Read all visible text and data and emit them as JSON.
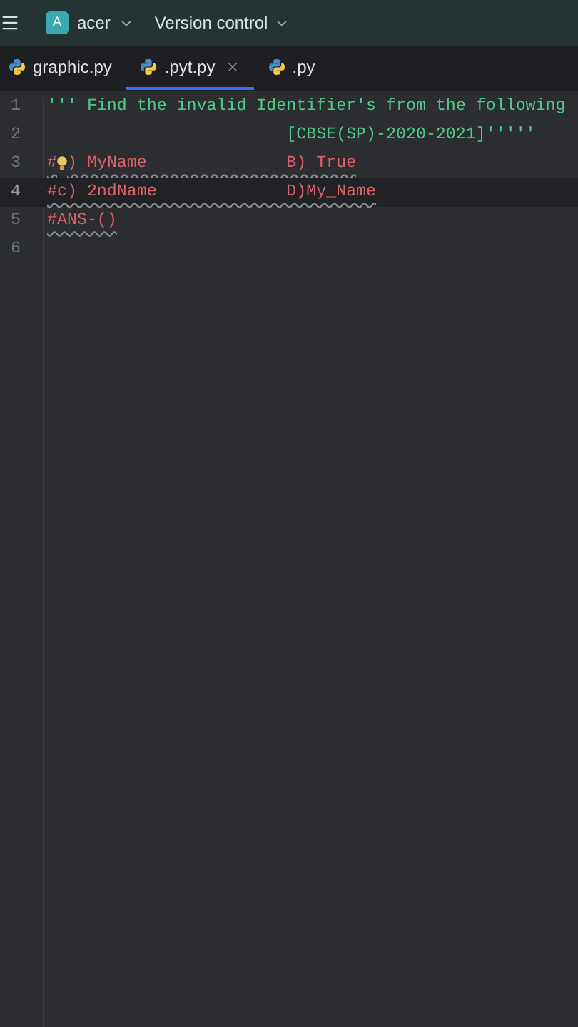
{
  "header": {
    "project_initial": "A",
    "project": "acer",
    "vcs": "Version control"
  },
  "tabs": [
    {
      "label": "graphic.py",
      "selected": false
    },
    {
      "label": ".pyt.py",
      "selected": true
    },
    {
      "label": ".py",
      "selected": false
    }
  ],
  "lines": [
    {
      "number": "1",
      "kind": "string",
      "current": false,
      "text": "''' Find the invalid Identifier's from the following"
    },
    {
      "number": "2",
      "kind": "string",
      "current": false,
      "text": "                        [CBSE(SP)-2020-2021]'''''"
    },
    {
      "number": "3",
      "kind": "comment",
      "current": false,
      "prefix": "#",
      "bulb": true,
      "text": ") MyName              B) True"
    },
    {
      "number": "4",
      "kind": "comment",
      "current": true,
      "text": "#c) 2ndName             D)My_Name"
    },
    {
      "number": "5",
      "kind": "comment",
      "current": false,
      "text": "#ANS-()"
    },
    {
      "number": "6",
      "current": false
    }
  ]
}
